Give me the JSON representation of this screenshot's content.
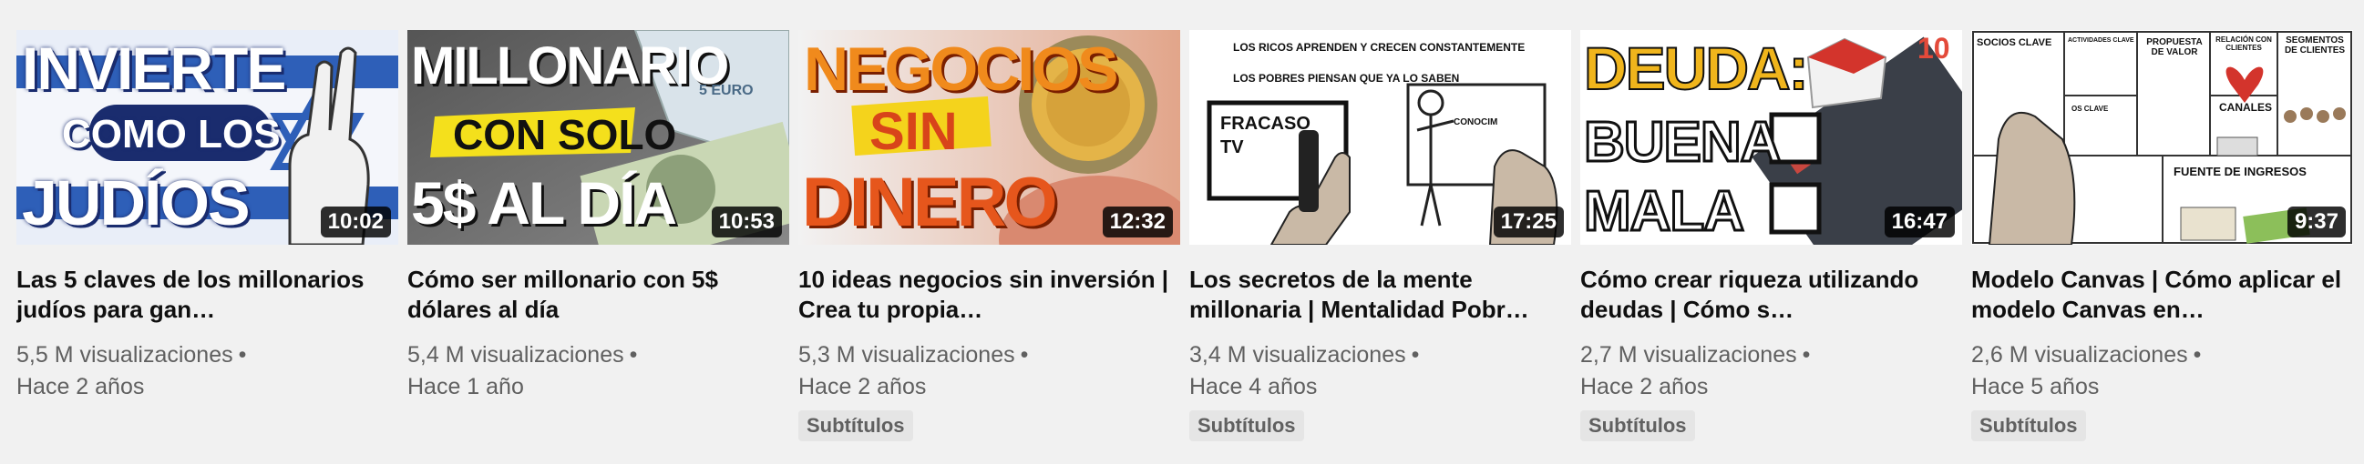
{
  "videos": [
    {
      "duration": "10:02",
      "title": "Las 5 claves de los millonarios judíos para gan…",
      "views": "5,5 M visualizaciones",
      "age": "Hace 2 años",
      "thumb_text": [
        "INVIERTE",
        "COMO LOS",
        "JUDÍOS"
      ]
    },
    {
      "duration": "10:53",
      "title": "Cómo ser millonario con 5$ dólares al día",
      "views": "5,4 M visualizaciones",
      "age": "Hace 1 año",
      "thumb_text": [
        "MILLONARIO",
        "CON SOLO",
        "5$ AL DÍA",
        "5 EURO"
      ]
    },
    {
      "duration": "12:32",
      "title": "10 ideas negocios sin inversión | Crea tu propia…",
      "views": "5,3 M visualizaciones",
      "age": "Hace 2 años",
      "badge": "Subtítulos",
      "thumb_text": [
        "NEGOCIOS",
        "SIN",
        "DINERO"
      ]
    },
    {
      "duration": "17:25",
      "title": "Los secretos de la mente millonaria | Mentalidad Pobr…",
      "views": "3,4 M visualizaciones",
      "age": "Hace 4 años",
      "badge": "Subtítulos",
      "thumb_text": [
        "LOS RICOS APRENDEN Y CRECEN CONSTANTEMENTE",
        "LOS POBRES PIENSAN QUE YA LO SABEN",
        "FRACASO",
        "TV",
        "CONOCIM"
      ]
    },
    {
      "duration": "16:47",
      "title": "Cómo crear riqueza utilizando deudas | Cómo s…",
      "views": "2,7 M visualizaciones",
      "age": "Hace 2 años",
      "badge": "Subtítulos",
      "thumb_text": [
        "DEUDA:",
        "BUENA",
        "MALA",
        "10"
      ]
    },
    {
      "duration": "9:37",
      "title": "Modelo Canvas | Cómo aplicar el modelo Canvas en…",
      "views": "2,6 M visualizaciones",
      "age": "Hace 5 años",
      "badge": "Subtítulos",
      "thumb_text": [
        "SOCIOS CLAVE",
        "ACTIVIDADES CLAVE",
        "PROPUESTA DE VALOR",
        "RELACIÓN CON CLIENTES",
        "SEGMENTOS DE CLIENTES",
        "OS CLAVE",
        "CANALES",
        "FUENTE DE INGRESOS"
      ]
    }
  ],
  "separator": "•",
  "colors": {
    "background": "#f1f1f1",
    "title": "#0f0f0f",
    "meta": "#606060",
    "badge_bg": "#e5e5e5"
  }
}
